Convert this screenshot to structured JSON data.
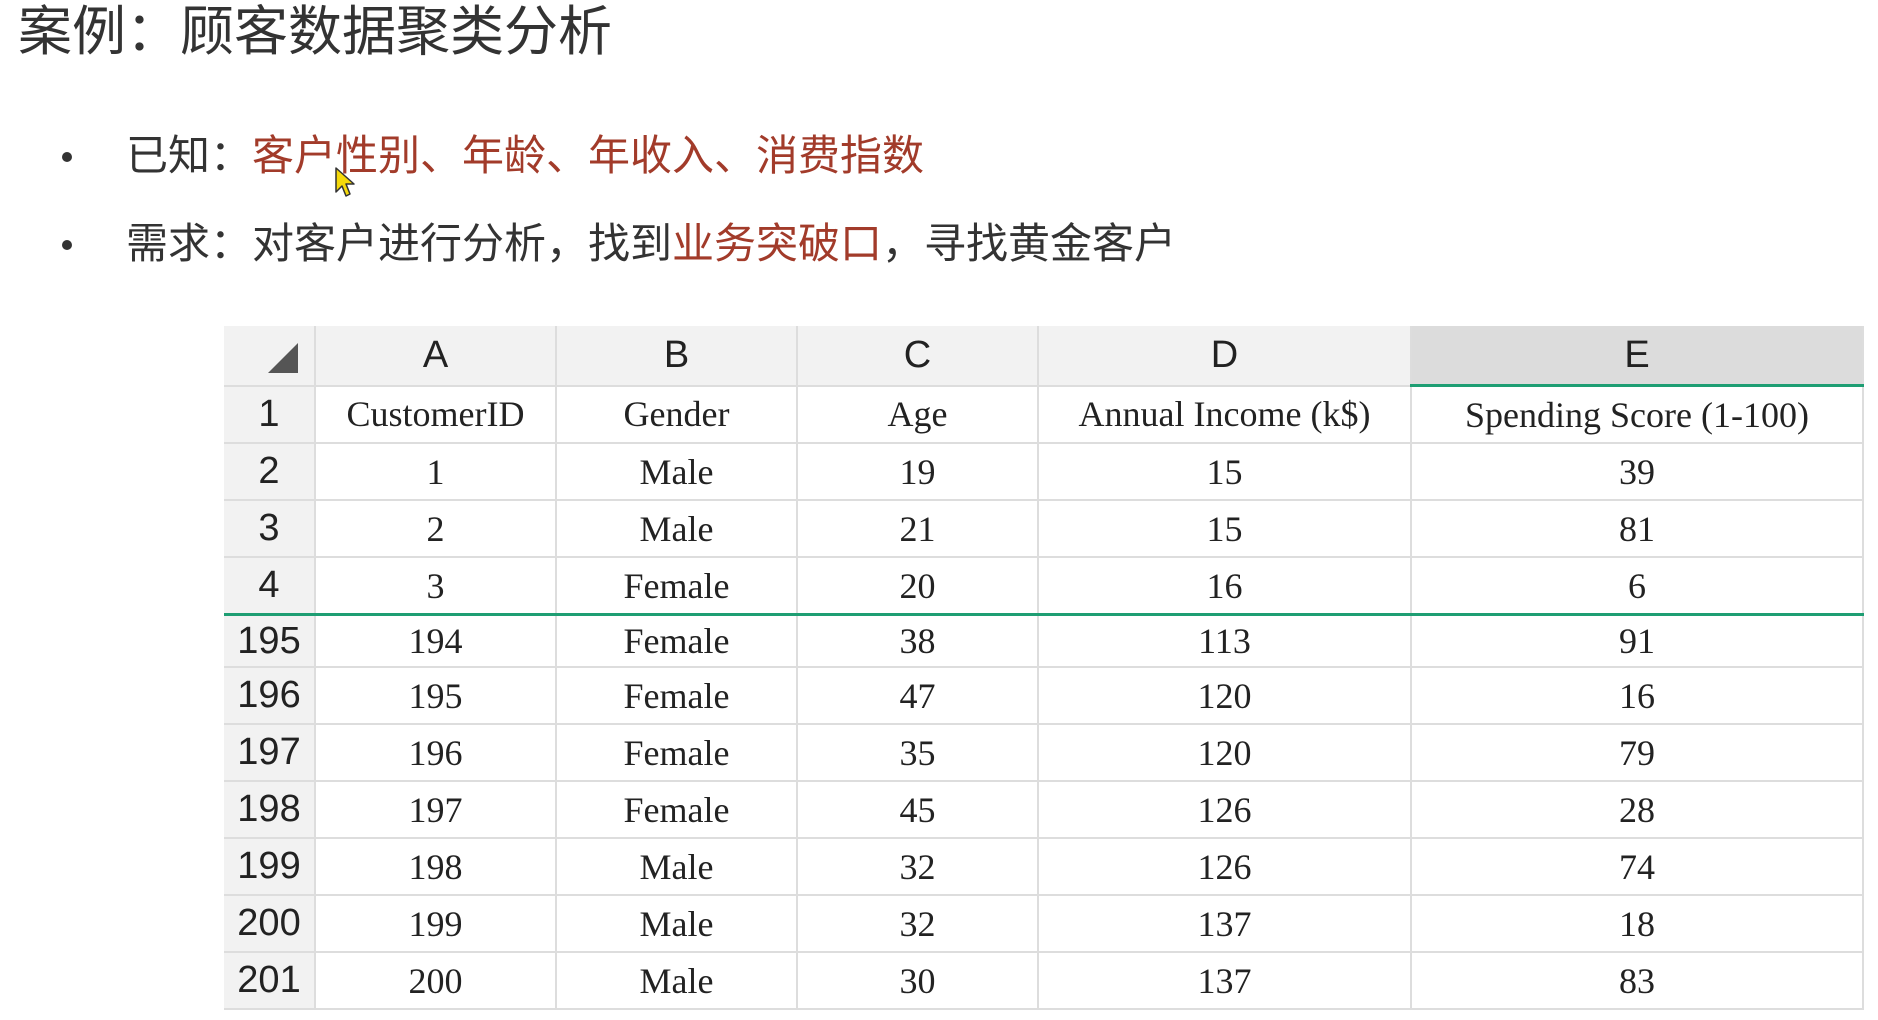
{
  "title": "案例：顾客数据聚类分析",
  "bullets": [
    {
      "prefix": "已知：",
      "highlight": "客户性别、年龄、年收入、消费指数",
      "suffix": ""
    },
    {
      "prefix": "需求：对客户进行分析，找到",
      "highlight": "业务突破口",
      "suffix": "，寻找黄金客户"
    }
  ],
  "colors": {
    "highlight": "#a23b2a",
    "selection_green": "#1e9e73",
    "header_bg": "#f2f2f2",
    "selected_header_bg": "#dcdcdc"
  },
  "sheet": {
    "column_letters": [
      "A",
      "B",
      "C",
      "D",
      "E"
    ],
    "selected_column": "E",
    "rows": [
      {
        "num": "1",
        "cells": [
          "CustomerID",
          "Gender",
          "Age",
          "Annual Income (k$)",
          "Spending Score (1-100)"
        ]
      },
      {
        "num": "2",
        "cells": [
          "1",
          "Male",
          "19",
          "15",
          "39"
        ]
      },
      {
        "num": "3",
        "cells": [
          "2",
          "Male",
          "21",
          "15",
          "81"
        ]
      },
      {
        "num": "4",
        "cells": [
          "3",
          "Female",
          "20",
          "16",
          "6"
        ]
      },
      {
        "num": "195",
        "cells": [
          "194",
          "Female",
          "38",
          "113",
          "91"
        ]
      },
      {
        "num": "196",
        "cells": [
          "195",
          "Female",
          "47",
          "120",
          "16"
        ]
      },
      {
        "num": "197",
        "cells": [
          "196",
          "Female",
          "35",
          "120",
          "79"
        ]
      },
      {
        "num": "198",
        "cells": [
          "197",
          "Female",
          "45",
          "126",
          "28"
        ]
      },
      {
        "num": "199",
        "cells": [
          "198",
          "Male",
          "32",
          "126",
          "74"
        ]
      },
      {
        "num": "200",
        "cells": [
          "199",
          "Male",
          "32",
          "137",
          "18"
        ]
      },
      {
        "num": "201",
        "cells": [
          "200",
          "Male",
          "30",
          "137",
          "83"
        ]
      }
    ]
  },
  "icons": {
    "cursor": "mouse-pointer-icon",
    "select_all": "select-all-triangle-icon"
  }
}
